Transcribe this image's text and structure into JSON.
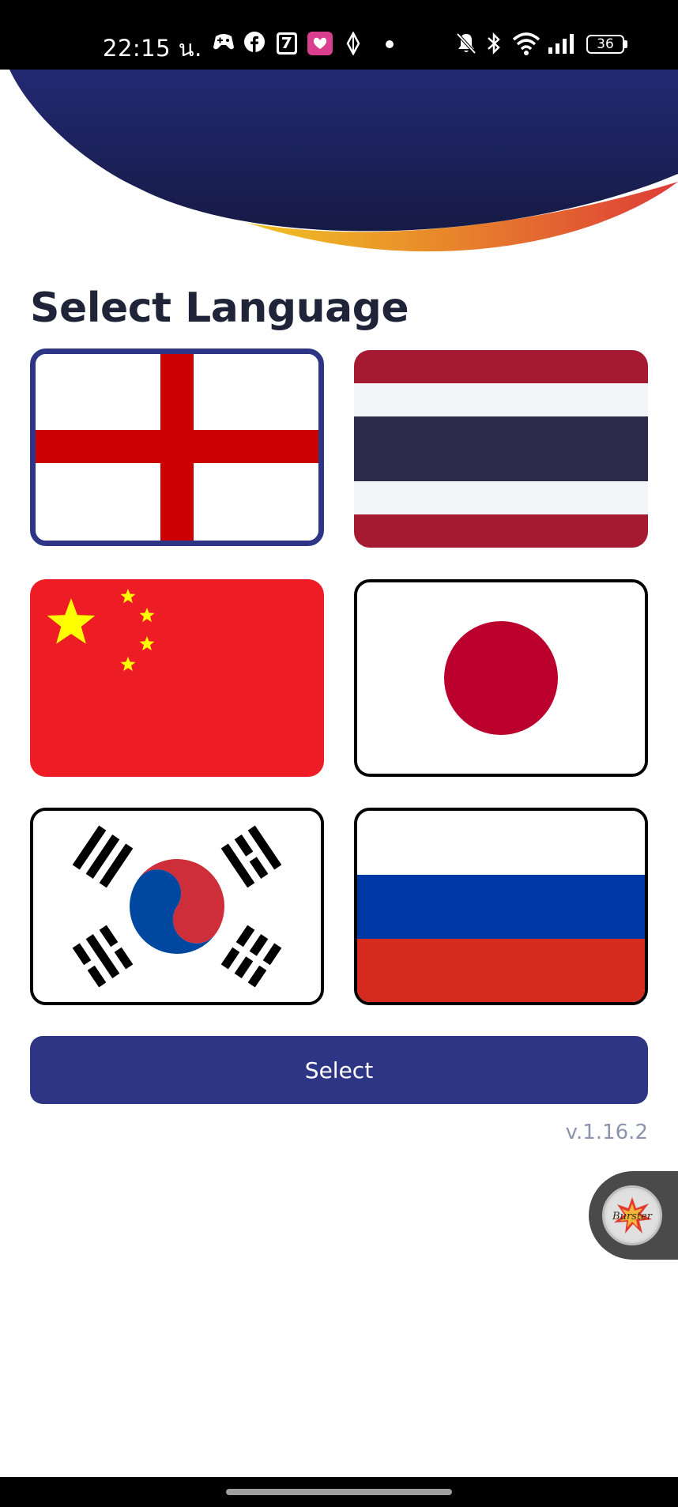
{
  "status_bar": {
    "time": "22:15 น.",
    "battery": "36"
  },
  "page": {
    "title": "Select Language",
    "select_label": "Select",
    "version": "v.1.16.2"
  },
  "colors": {
    "primary": "#2e3585",
    "header_navy": "#1c2157",
    "accent_yellow": "#f0d920",
    "accent_red": "#e03f37"
  },
  "languages": [
    {
      "flag": "england-flag",
      "selected": true
    },
    {
      "flag": "thailand-flag",
      "selected": false
    },
    {
      "flag": "china-flag",
      "selected": false
    },
    {
      "flag": "japan-flag",
      "selected": false
    },
    {
      "flag": "south-korea-flag",
      "selected": false
    },
    {
      "flag": "russia-flag",
      "selected": false
    }
  ],
  "floating_widget": {
    "icon": "burster-app-icon"
  }
}
